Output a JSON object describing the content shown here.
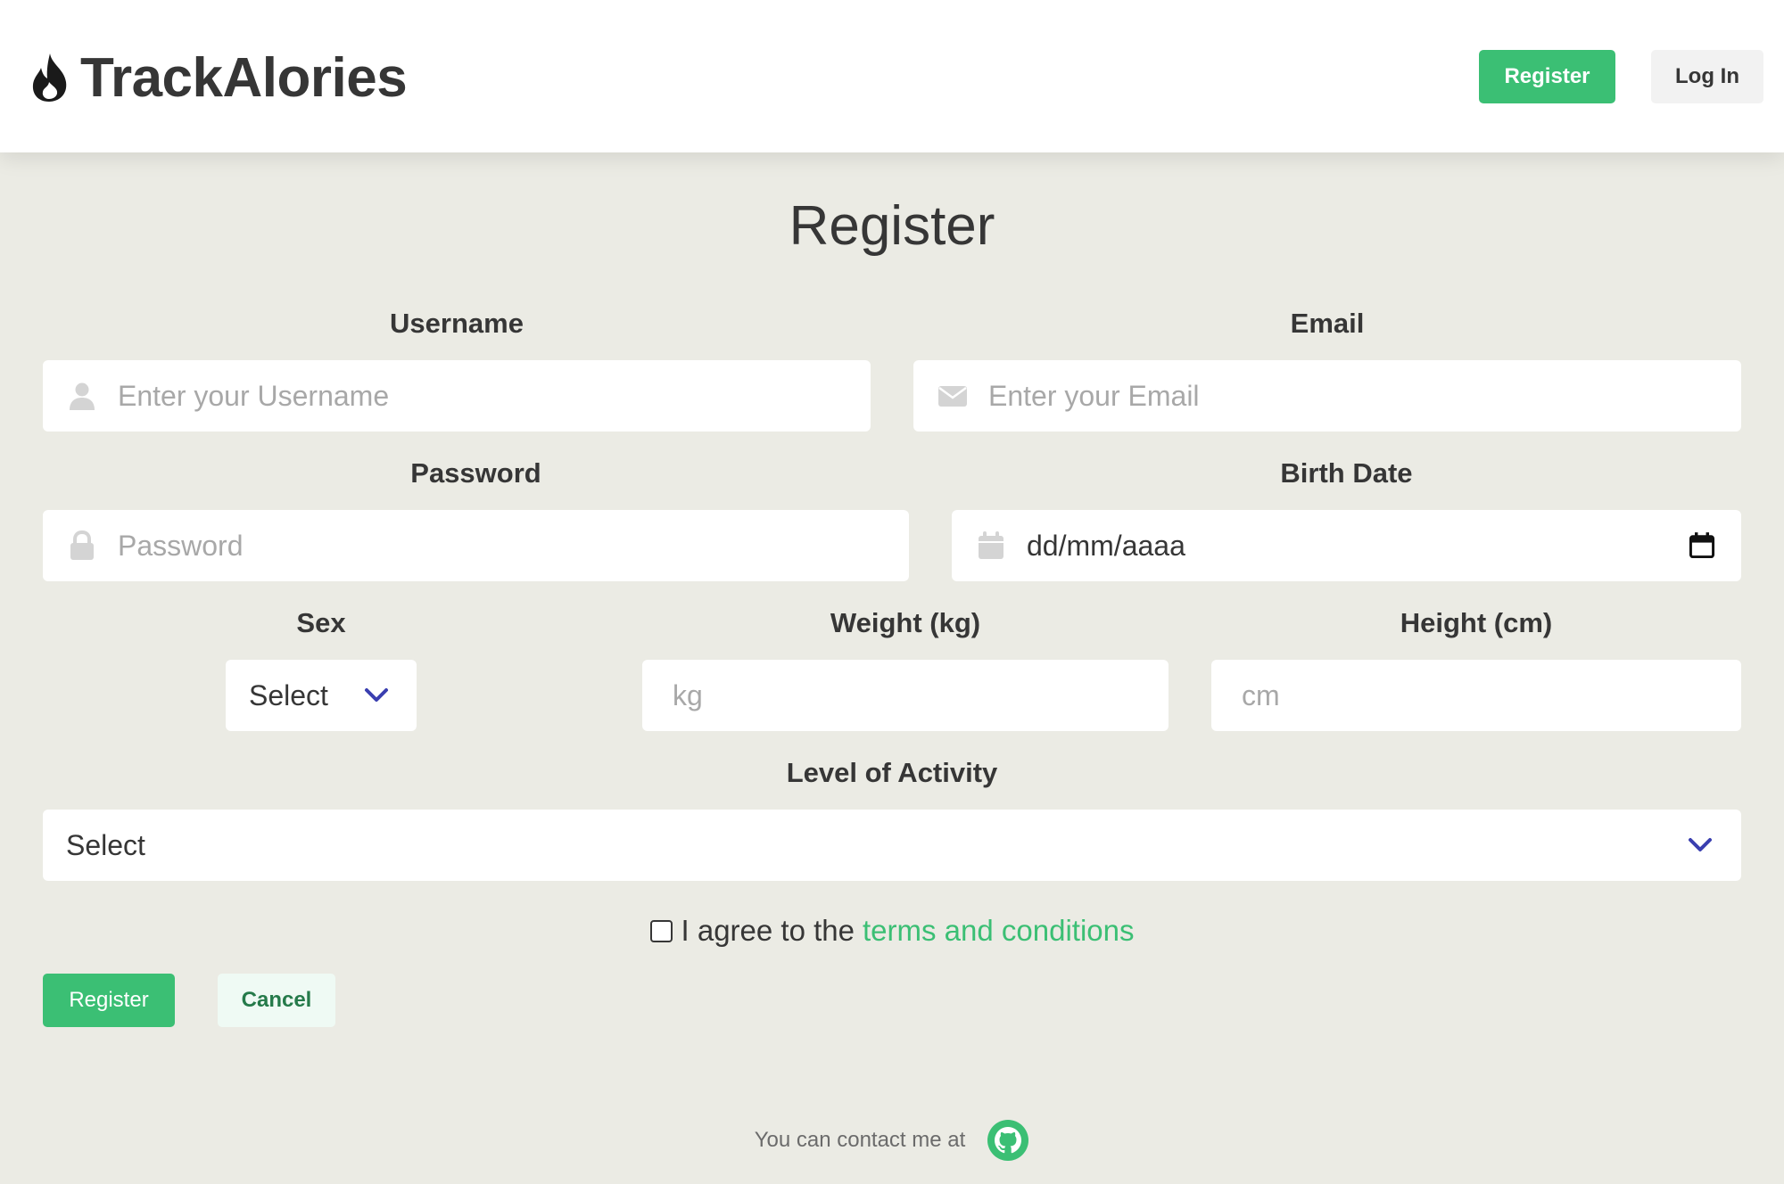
{
  "brand": {
    "name": "TrackAlories",
    "icon": "flame-icon"
  },
  "nav": {
    "register_label": "Register",
    "login_label": "Log In"
  },
  "page_title": "Register",
  "form": {
    "username": {
      "label": "Username",
      "placeholder": "Enter your Username",
      "icon": "user-icon"
    },
    "email": {
      "label": "Email",
      "placeholder": "Enter your Email",
      "icon": "envelope-icon"
    },
    "password": {
      "label": "Password",
      "placeholder": "Password",
      "icon": "lock-icon"
    },
    "birth_date": {
      "label": "Birth Date",
      "value": "dd/mm/aaaa",
      "icon": "calendar-icon"
    },
    "sex": {
      "label": "Sex",
      "selected": "Select"
    },
    "weight": {
      "label": "Weight (kg)",
      "placeholder": "kg"
    },
    "height": {
      "label": "Height (cm)",
      "placeholder": "cm"
    },
    "activity": {
      "label": "Level of Activity",
      "selected": "Select"
    },
    "terms": {
      "prefix": "I agree to the",
      "link": "terms and conditions",
      "checked": false
    },
    "register_label": "Register",
    "cancel_label": "Cancel"
  },
  "footer": {
    "text": "You can contact me at",
    "icon": "github-icon"
  },
  "colors": {
    "primary": "#3bbf74",
    "background": "#ebebe4",
    "text": "#363636",
    "chevron": "#3a3fb0"
  }
}
